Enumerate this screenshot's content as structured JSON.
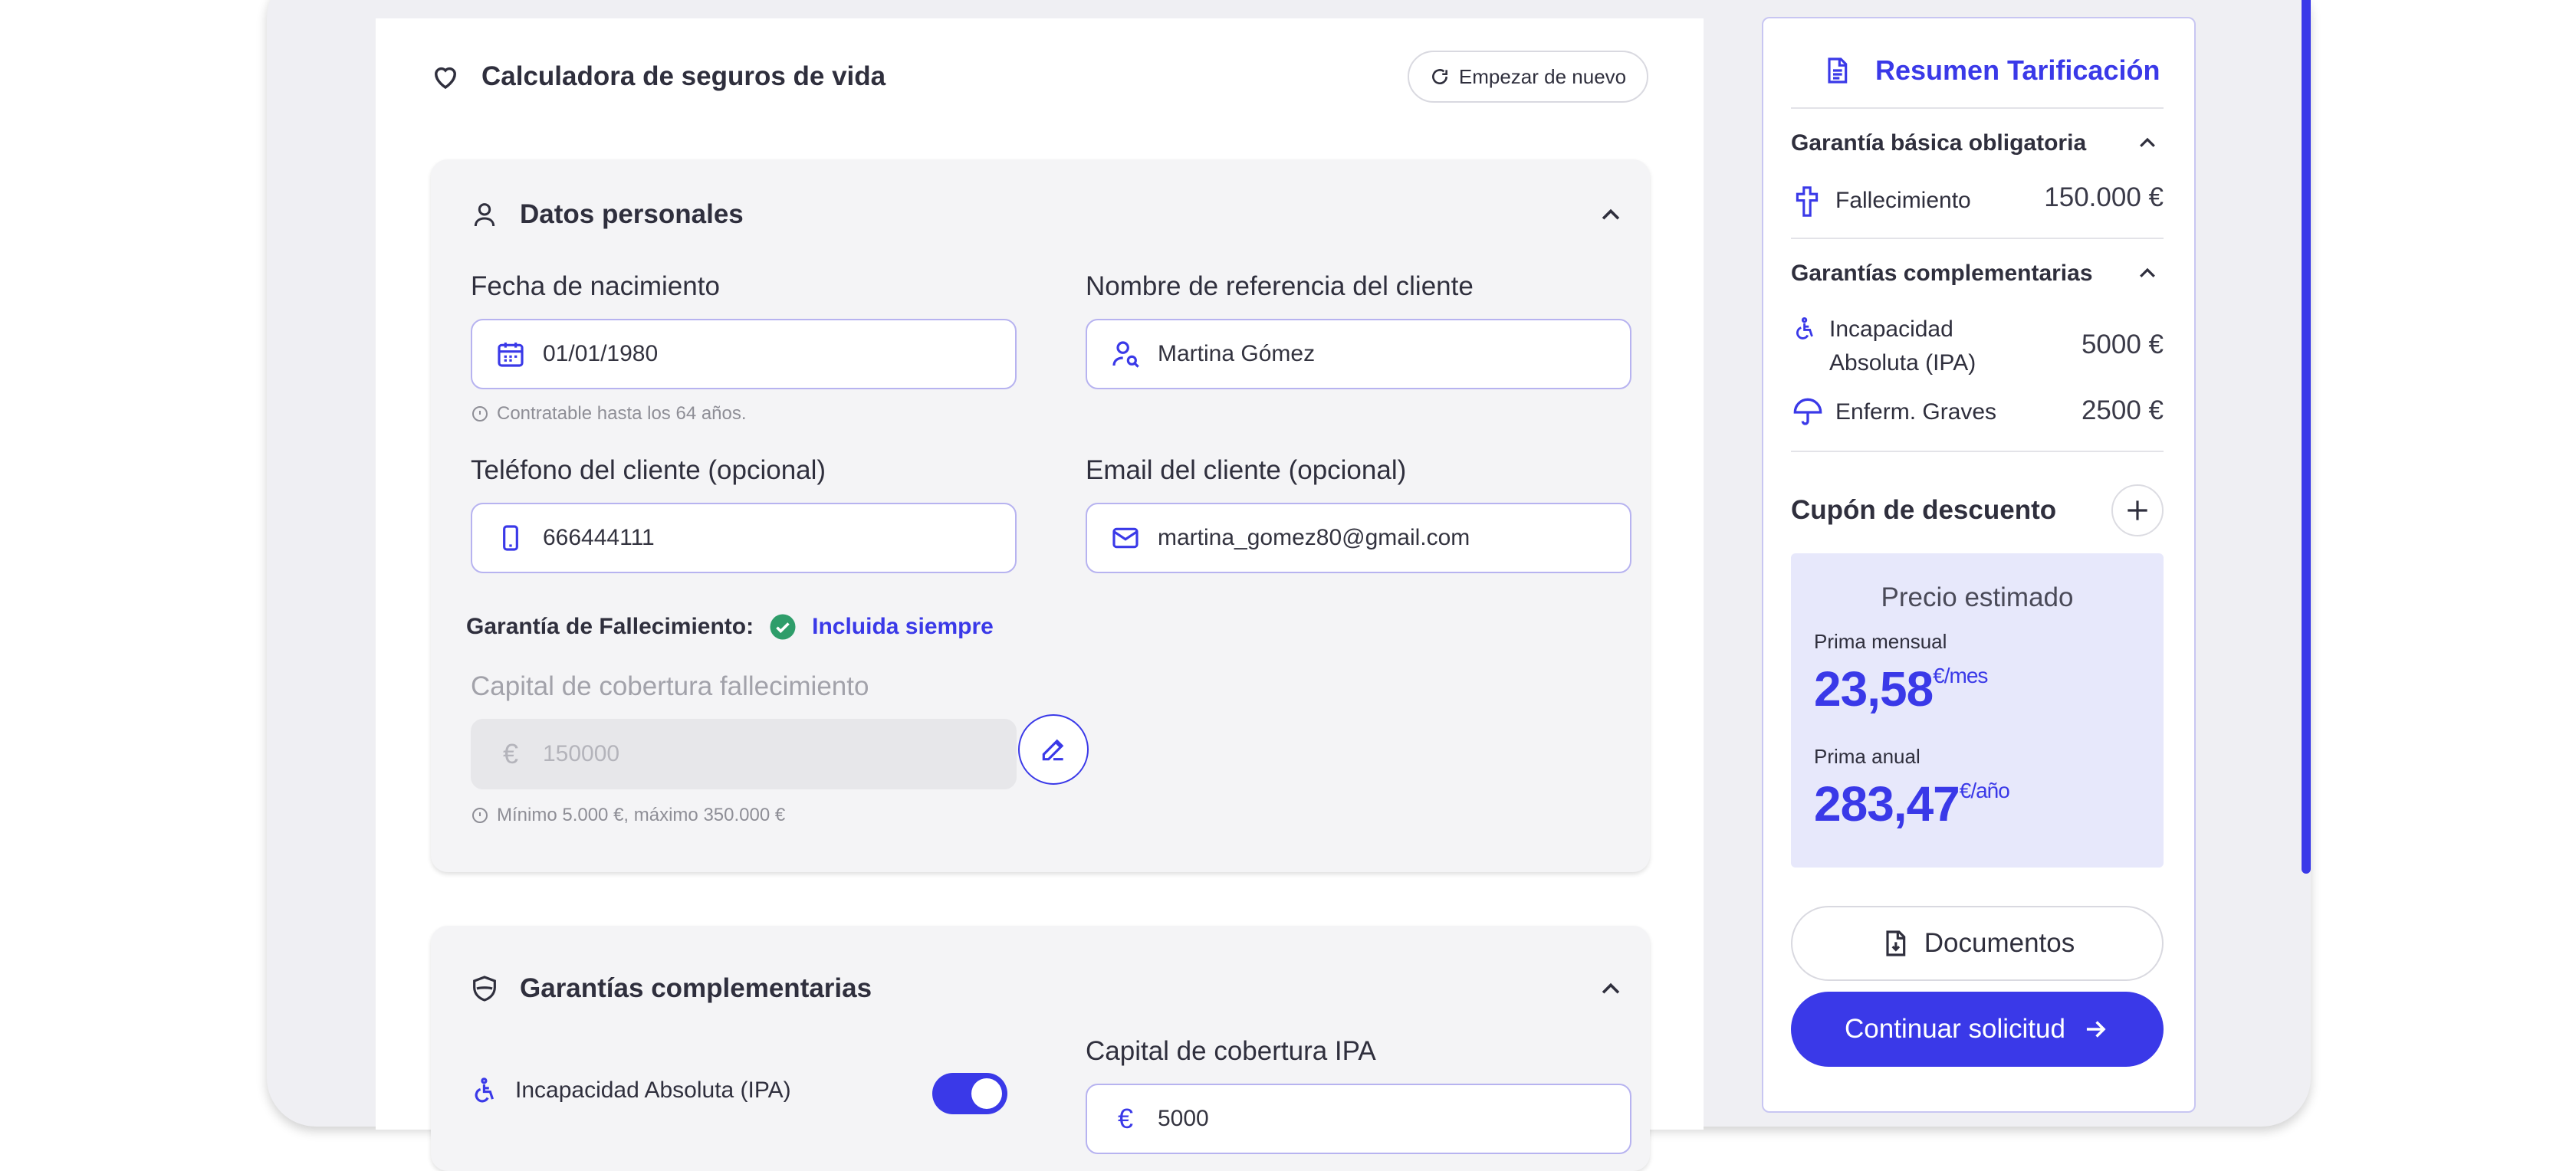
{
  "header": {
    "title": "Calculadora de seguros de vida",
    "restart_label": "Empezar de nuevo"
  },
  "personal": {
    "section_title": "Datos personales",
    "birth_label": "Fecha de nacimiento",
    "birth_value": "01/01/1980",
    "birth_hint": "Contratable hasta los 64 años.",
    "name_label": "Nombre de referencia del cliente",
    "name_value": "Martina Gómez",
    "phone_label": "Teléfono del cliente (opcional)",
    "phone_value": "666444111",
    "email_label": "Email del cliente (opcional)",
    "email_value": "martina_gomez80@gmail.com",
    "guarantee_label": "Garantía de Fallecimiento:",
    "guarantee_status": "Incluida siempre",
    "capital_label": "Capital de cobertura fallecimiento",
    "capital_value": "150000",
    "capital_hint": "Mínimo 5.000 €, máximo 350.000 €"
  },
  "complementary": {
    "section_title": "Garantías complementarias",
    "ipa_label": "Incapacidad Absoluta (IPA)",
    "ipa_enabled": true,
    "ipa_capital_label": "Capital de cobertura IPA",
    "ipa_capital_value": "5000"
  },
  "summary": {
    "title": "Resumen Tarificación",
    "basic_head": "Garantía básica obligatoria",
    "death_label": "Fallecimiento",
    "death_value": "150.000 €",
    "comp_head": "Garantías complementarias",
    "ipa_label_1": "Incapacidad",
    "ipa_label_2": "Absoluta (IPA)",
    "ipa_value": "5000 €",
    "illness_label": "Enferm. Graves",
    "illness_value": "2500 €",
    "coupon_label": "Cupón de descuento",
    "price_title": "Precio estimado",
    "monthly_label": "Prima mensual",
    "monthly_value": "23,58",
    "monthly_unit": "€/mes",
    "annual_label": "Prima anual",
    "annual_value": "283,47",
    "annual_unit": "€/año",
    "docs_label": "Documentos",
    "cta_label": "Continuar solicitud"
  },
  "colors": {
    "accent": "#3a39e8",
    "success": "#2e9d6a",
    "price_bg": "#e7e8fb"
  },
  "icons": [
    "heart-icon",
    "refresh-icon",
    "user-icon",
    "calendar-icon",
    "user-search-icon",
    "phone-icon",
    "mail-icon",
    "check-circle-icon",
    "euro-icon",
    "edit-icon",
    "shield-icon",
    "wheelchair-icon",
    "cross-icon",
    "umbrella-icon",
    "document-icon",
    "plus-icon",
    "download-doc-icon",
    "arrow-right-icon",
    "chevron-up-icon",
    "info-icon"
  ]
}
